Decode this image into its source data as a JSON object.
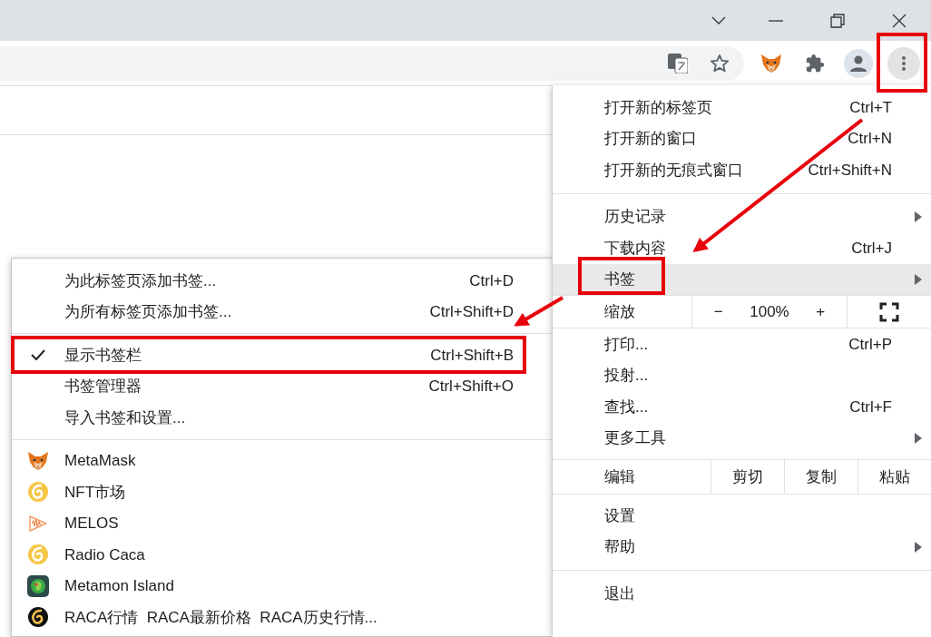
{
  "menu": {
    "items": [
      {
        "kind": "item",
        "label": "打开新的标签页",
        "shortcut": "Ctrl+T",
        "submenu": false,
        "selected": false
      },
      {
        "kind": "item",
        "label": "打开新的窗口",
        "shortcut": "Ctrl+N",
        "submenu": false,
        "selected": false
      },
      {
        "kind": "item",
        "label": "打开新的无痕式窗口",
        "shortcut": "Ctrl+Shift+N",
        "submenu": false,
        "selected": false
      },
      {
        "kind": "separator"
      },
      {
        "kind": "item",
        "label": "历史记录",
        "submenu": true,
        "selected": false
      },
      {
        "kind": "item",
        "label": "下载内容",
        "shortcut": "Ctrl+J",
        "submenu": false,
        "selected": false
      },
      {
        "kind": "item",
        "label": "书签",
        "submenu": true,
        "selected": true
      },
      {
        "kind": "zoom",
        "label": "缩放",
        "minus": "−",
        "value": "100%",
        "plus": "+"
      },
      {
        "kind": "item",
        "label": "打印...",
        "shortcut": "Ctrl+P",
        "submenu": false,
        "selected": false
      },
      {
        "kind": "item",
        "label": "投射...",
        "submenu": false,
        "selected": false
      },
      {
        "kind": "item",
        "label": "查找...",
        "shortcut": "Ctrl+F",
        "submenu": false,
        "selected": false
      },
      {
        "kind": "item",
        "label": "更多工具",
        "submenu": true,
        "selected": false
      },
      {
        "kind": "edit",
        "label": "编辑",
        "actions": [
          "剪切",
          "复制",
          "粘贴"
        ]
      },
      {
        "kind": "item",
        "label": "设置",
        "submenu": false,
        "selected": false
      },
      {
        "kind": "item",
        "label": "帮助",
        "submenu": true,
        "selected": false
      },
      {
        "kind": "separator"
      },
      {
        "kind": "item",
        "label": "退出",
        "submenu": false,
        "selected": false
      }
    ]
  },
  "bookmarks_submenu": {
    "items": [
      {
        "kind": "action",
        "label": "为此标签页添加书签...",
        "shortcut": "Ctrl+D",
        "checked": false
      },
      {
        "kind": "action",
        "label": "为所有标签页添加书签...",
        "shortcut": "Ctrl+Shift+D",
        "checked": false
      },
      {
        "kind": "separator"
      },
      {
        "kind": "action",
        "label": "显示书签栏",
        "shortcut": "Ctrl+Shift+B",
        "checked": true
      },
      {
        "kind": "action",
        "label": "书签管理器",
        "shortcut": "Ctrl+Shift+O",
        "checked": false
      },
      {
        "kind": "action",
        "label": "导入书签和设置...",
        "checked": false
      },
      {
        "kind": "separator"
      },
      {
        "kind": "bookmark",
        "label": "MetaMask"
      },
      {
        "kind": "bookmark",
        "label": "NFT市场"
      },
      {
        "kind": "bookmark",
        "label": "MELOS"
      },
      {
        "kind": "bookmark",
        "label": "Radio Caca"
      },
      {
        "kind": "bookmark",
        "label": "Metamon Island"
      },
      {
        "kind": "bookmark",
        "label": "RACA行情  RACA最新价格  RACA历史行情..."
      }
    ]
  }
}
